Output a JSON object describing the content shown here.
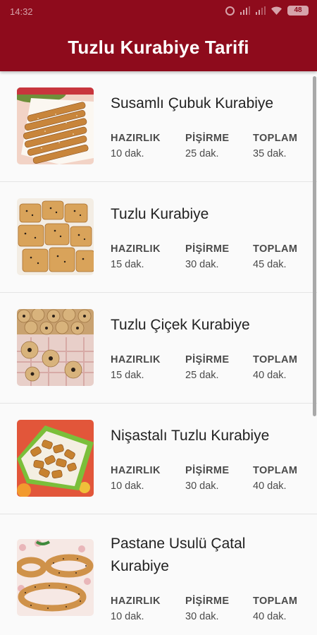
{
  "status_bar": {
    "time": "14:32",
    "battery": "48"
  },
  "app_bar": {
    "title": "Tuzlu Kurabiye Tarifi"
  },
  "labels": {
    "prep": "HAZIRLIK",
    "cook": "PİŞİRME",
    "total": "TOPLAM"
  },
  "recipes": [
    {
      "name": "Susamlı Çubuk Kurabiye",
      "prep": "10 dak.",
      "cook": "25 dak.",
      "total": "35 dak."
    },
    {
      "name": "Tuzlu Kurabiye",
      "prep": "15 dak.",
      "cook": "30 dak.",
      "total": "45 dak."
    },
    {
      "name": "Tuzlu Çiçek Kurabiye",
      "prep": "15 dak.",
      "cook": "25 dak.",
      "total": "40 dak."
    },
    {
      "name": "Nişastalı Tuzlu Kurabiye",
      "prep": "10 dak.",
      "cook": "30 dak.",
      "total": "40 dak."
    },
    {
      "name": "Pastane Usulü Çatal Kurabiye",
      "prep": "10 dak.",
      "cook": "30 dak.",
      "total": "40 dak."
    }
  ],
  "colors": {
    "app_bar": "#8e0b1c",
    "list_bg": "#fafafa",
    "text": "#222222"
  }
}
